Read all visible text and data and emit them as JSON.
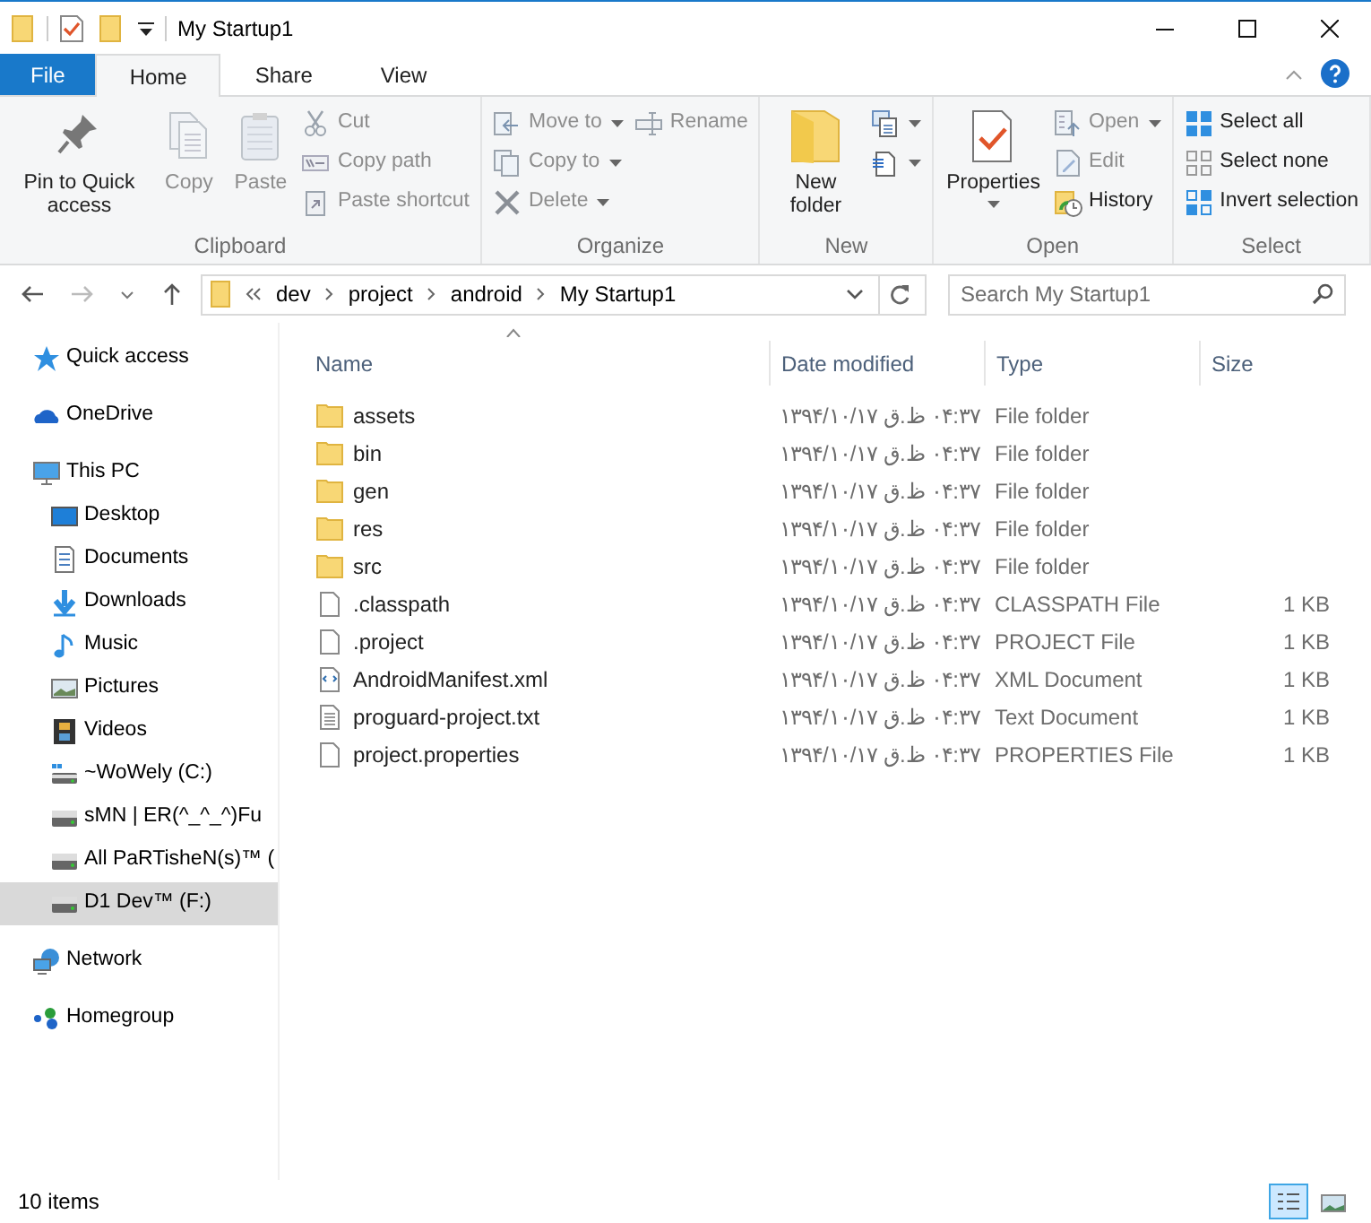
{
  "window": {
    "title": "My Startup1"
  },
  "ribbon": {
    "tabs": [
      {
        "label": "File",
        "kind": "file",
        "selected": false
      },
      {
        "label": "Home",
        "kind": "tab",
        "selected": true
      },
      {
        "label": "Share",
        "kind": "tab",
        "selected": false
      },
      {
        "label": "View",
        "kind": "tab",
        "selected": false
      }
    ],
    "groups": [
      {
        "label": "Clipboard",
        "items": [
          {
            "kind": "large",
            "label": "Pin to Quick access",
            "disabled": false
          },
          {
            "kind": "large",
            "label": "Copy",
            "disabled": true
          },
          {
            "kind": "large",
            "label": "Paste",
            "disabled": true
          },
          {
            "kind": "small",
            "label": "Cut",
            "disabled": true
          },
          {
            "kind": "small",
            "label": "Copy path",
            "disabled": true
          },
          {
            "kind": "small",
            "label": "Paste shortcut",
            "disabled": true
          }
        ]
      },
      {
        "label": "Organize",
        "items": [
          {
            "kind": "small",
            "label": "Move to",
            "disabled": true,
            "dropdown": true
          },
          {
            "kind": "small",
            "label": "Copy to",
            "disabled": true,
            "dropdown": true
          },
          {
            "kind": "small",
            "label": "Delete",
            "disabled": true,
            "dropdown": true
          },
          {
            "kind": "small",
            "label": "Rename",
            "disabled": true
          }
        ]
      },
      {
        "label": "New",
        "items": [
          {
            "kind": "large",
            "label": "New folder",
            "disabled": false
          },
          {
            "kind": "small",
            "disabled": false,
            "dropdown": true
          },
          {
            "kind": "small",
            "disabled": false,
            "dropdown": true
          }
        ]
      },
      {
        "label": "Open",
        "items": [
          {
            "kind": "large",
            "label": "Properties",
            "disabled": false,
            "dropdown": true
          },
          {
            "kind": "small",
            "label": "Open",
            "disabled": true,
            "dropdown": true
          },
          {
            "kind": "small",
            "label": "Edit",
            "disabled": true
          },
          {
            "kind": "small",
            "label": "History",
            "disabled": false
          }
        ]
      },
      {
        "label": "Select",
        "items": [
          {
            "kind": "small",
            "label": "Select all",
            "disabled": false
          },
          {
            "kind": "small",
            "label": "Select none",
            "disabled": false
          },
          {
            "kind": "small",
            "label": "Invert selection",
            "disabled": false
          }
        ]
      }
    ]
  },
  "address": {
    "path": [
      "dev",
      "project",
      "android",
      "My Startup1"
    ],
    "search_placeholder": "Search My Startup1"
  },
  "sidebar": {
    "items": [
      {
        "label": "Quick access",
        "selected": false
      },
      {
        "label": "OneDrive",
        "selected": false
      },
      {
        "label": "This PC",
        "selected": false,
        "children": [
          {
            "label": "Desktop",
            "selected": false
          },
          {
            "label": "Documents",
            "selected": false
          },
          {
            "label": "Downloads",
            "selected": false
          },
          {
            "label": "Music",
            "selected": false
          },
          {
            "label": "Pictures",
            "selected": false
          },
          {
            "label": "Videos",
            "selected": false
          },
          {
            "label": "~WoWely (C:)",
            "selected": false
          },
          {
            "label": "sMN | ER(^_^_^)Fu",
            "selected": false
          },
          {
            "label": "All PaRTisheN(s)™ (",
            "selected": false
          },
          {
            "label": "D1 Dev™ (F:)",
            "selected": true
          }
        ]
      },
      {
        "label": "Network",
        "selected": false
      },
      {
        "label": "Homegroup",
        "selected": false
      }
    ]
  },
  "table": {
    "columns": [
      "Name",
      "Date modified",
      "Type",
      "Size"
    ],
    "rows": [
      {
        "kind": "folder",
        "name": "assets",
        "date": "۱۳۹۴/۱۰/۱۷ ق.ظ ۰۴:۳۷",
        "type": "File folder"
      },
      {
        "kind": "folder",
        "name": "bin",
        "date": "۱۳۹۴/۱۰/۱۷ ق.ظ ۰۴:۳۷",
        "type": "File folder"
      },
      {
        "kind": "folder",
        "name": "gen",
        "date": "۱۳۹۴/۱۰/۱۷ ق.ظ ۰۴:۳۷",
        "type": "File folder"
      },
      {
        "kind": "folder",
        "name": "res",
        "date": "۱۳۹۴/۱۰/۱۷ ق.ظ ۰۴:۳۷",
        "type": "File folder"
      },
      {
        "kind": "folder",
        "name": "src",
        "date": "۱۳۹۴/۱۰/۱۷ ق.ظ ۰۴:۳۷",
        "type": "File folder"
      },
      {
        "kind": "file",
        "name": ".classpath",
        "date": "۱۳۹۴/۱۰/۱۷ ق.ظ ۰۴:۳۷",
        "type": "CLASSPATH File",
        "size": "1 KB"
      },
      {
        "kind": "file",
        "name": ".project",
        "date": "۱۳۹۴/۱۰/۱۷ ق.ظ ۰۴:۳۷",
        "type": "PROJECT File",
        "size": "1 KB"
      },
      {
        "kind": "xml",
        "name": "AndroidManifest.xml",
        "date": "۱۳۹۴/۱۰/۱۷ ق.ظ ۰۴:۳۷",
        "type": "XML Document",
        "size": "1 KB"
      },
      {
        "kind": "text",
        "name": "proguard-project.txt",
        "date": "۱۳۹۴/۱۰/۱۷ ق.ظ ۰۴:۳۷",
        "type": "Text Document",
        "size": "1 KB"
      },
      {
        "kind": "file",
        "name": "project.properties",
        "date": "۱۳۹۴/۱۰/۱۷ ق.ظ ۰۴:۳۷",
        "type": "PROPERTIES File",
        "size": "1 KB"
      }
    ]
  },
  "status_bar": {
    "count": "10 items",
    "views": [
      {
        "kind": "details",
        "selected": true
      },
      {
        "kind": "large-icons",
        "selected": false
      }
    ]
  }
}
